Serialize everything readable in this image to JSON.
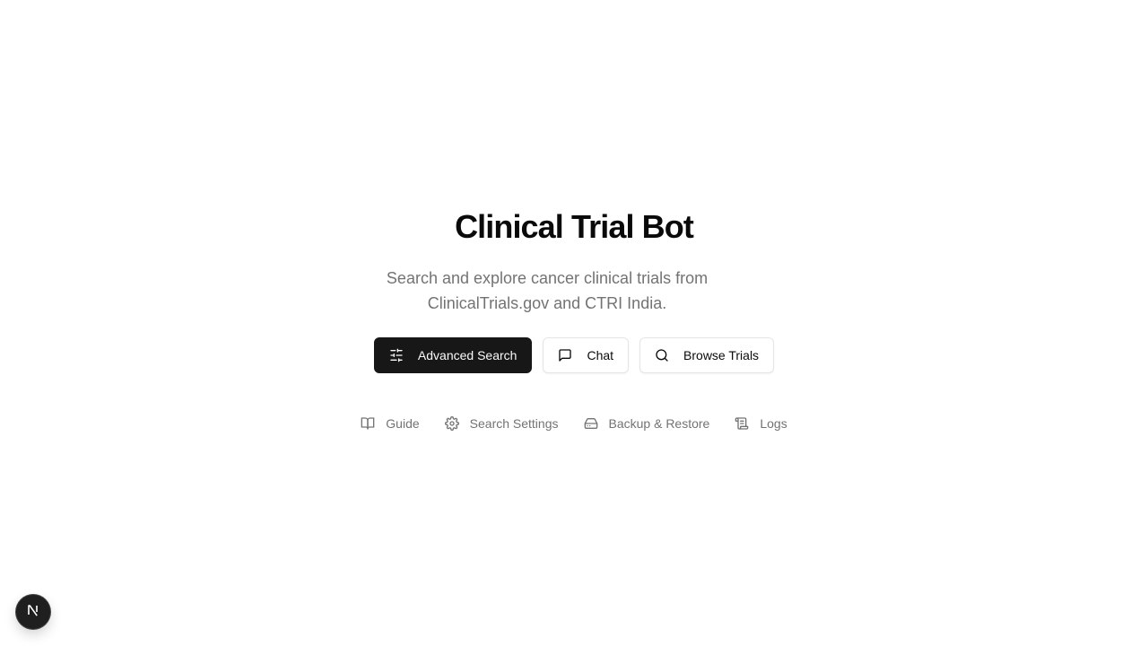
{
  "hero": {
    "title": "Clinical Trial Bot",
    "subtitle": "Search and explore cancer clinical trials from ClinicalTrials.gov and CTRI India."
  },
  "actions": [
    {
      "label": "Advanced Search",
      "icon": "sliders-icon",
      "style": "primary"
    },
    {
      "label": "Chat",
      "icon": "message-square-icon",
      "style": "outline"
    },
    {
      "label": "Browse Trials",
      "icon": "search-icon",
      "style": "outline"
    }
  ],
  "links": [
    {
      "label": "Guide",
      "icon": "book-open-icon"
    },
    {
      "label": "Search Settings",
      "icon": "gear-icon"
    },
    {
      "label": "Backup & Restore",
      "icon": "hard-drive-icon"
    },
    {
      "label": "Logs",
      "icon": "scroll-icon"
    }
  ],
  "dev_badge": {
    "letter": "N",
    "icon": "nextjs-logo-icon"
  },
  "colors": {
    "primary_bg": "#171717",
    "primary_text": "#fafafa",
    "muted_text": "#737373",
    "border": "#e5e5e5",
    "background": "#ffffff"
  }
}
